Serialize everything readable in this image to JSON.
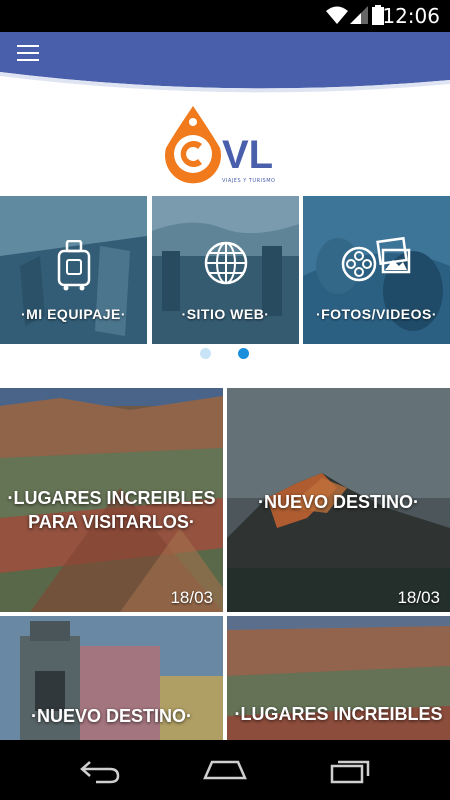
{
  "status_bar": {
    "time": "12:06",
    "icons": [
      "wifi-icon",
      "signal-icon",
      "battery-icon"
    ]
  },
  "app_bar": {
    "color": "#4a5fac",
    "menu_icon": "menu-icon"
  },
  "logo": {
    "text": "VL",
    "tagline": "VIAJES Y TURISMO",
    "accent": "#f07a1c",
    "brand": "#4a5fac"
  },
  "carousel": {
    "cards": [
      {
        "label": "·MI EQUIPAJE·",
        "icon": "luggage-icon"
      },
      {
        "label": "·SITIO WEB·",
        "icon": "globe-icon"
      },
      {
        "label": "·FOTOS/VIDEOS·",
        "icon": "media-icon"
      }
    ],
    "page_count": 2,
    "active_page": 2
  },
  "tiles": [
    {
      "title_line1": "·LUGARES INCREIBLES",
      "title_line2": "PARA VISITARLOS·",
      "date": "18/03"
    },
    {
      "title_line1": "·NUEVO DESTINO·",
      "title_line2": "",
      "date": "18/03"
    },
    {
      "title_line1": "·NUEVO DESTINO·",
      "title_line2": "",
      "date": ""
    },
    {
      "title_line1": "·LUGARES INCREIBLES",
      "title_line2": "",
      "date": ""
    }
  ],
  "nav_bar": {
    "buttons": [
      "back-icon",
      "home-icon",
      "recents-icon"
    ]
  }
}
